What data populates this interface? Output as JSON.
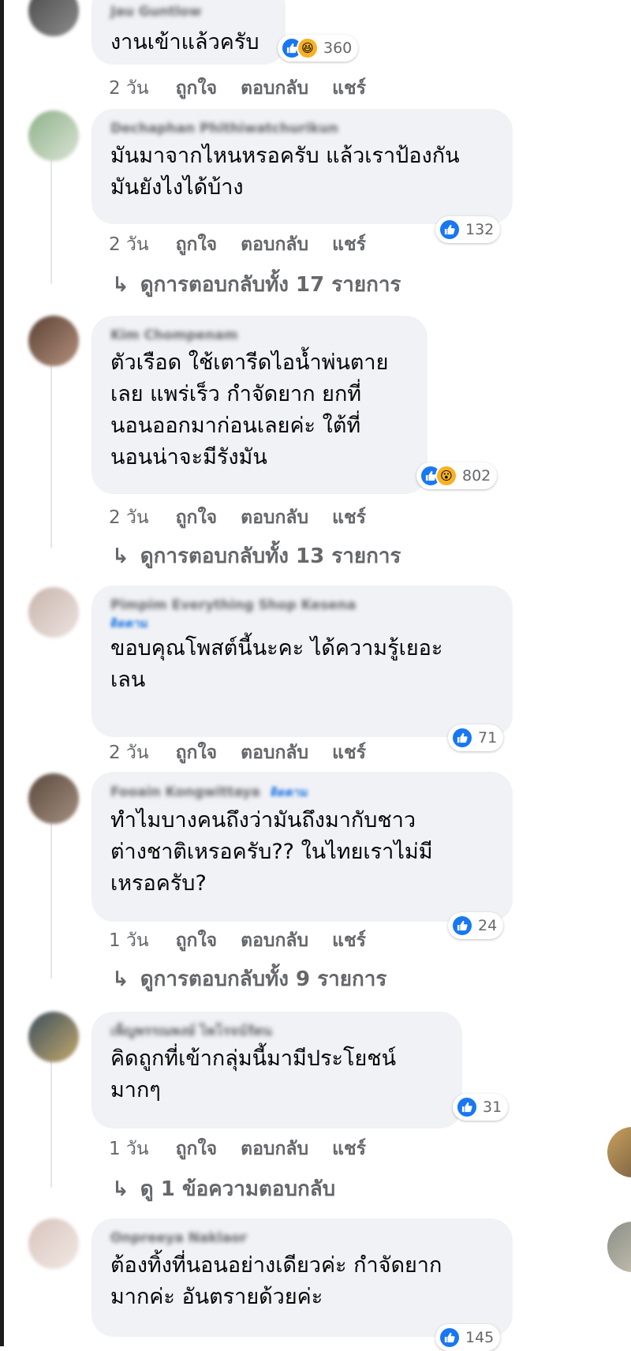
{
  "comments": [
    {
      "author": "Jau Guntlow",
      "badge": "",
      "text": "งานเข้าแล้วครับ",
      "reactions": [
        "like",
        "haha"
      ],
      "reaction_count": "360",
      "time": "2 วัน",
      "like": "ถูกใจ",
      "reply": "ตอบกลับ",
      "share": "แชร์",
      "view_replies": ""
    },
    {
      "author": "Dechaphan Phithiwatchurikun",
      "badge": "",
      "text": "มันมาจากไหนหรอครับ แล้วเราป้องกัน\nมันยังไงได้บ้าง",
      "reactions": [
        "like"
      ],
      "reaction_count": "132",
      "time": "2 วัน",
      "like": "ถูกใจ",
      "reply": "ตอบกลับ",
      "share": "แชร์",
      "view_replies": "ดูการตอบกลับทั้ง 17 รายการ"
    },
    {
      "author": "Kim Chompenam",
      "badge": "",
      "text": "ตัวเรือด ใช้เตารีดไอน้ำพ่นตาย\nเลย แพร่เร็ว กำจัดยาก ยกที่\nนอนออกมาก่อนเลยค่ะ ใต้ที่\nนอนน่าจะมีรังมัน",
      "reactions": [
        "like",
        "wow"
      ],
      "reaction_count": "802",
      "time": "2 วัน",
      "like": "ถูกใจ",
      "reply": "ตอบกลับ",
      "share": "แชร์",
      "view_replies": "ดูการตอบกลับทั้ง 13 รายการ"
    },
    {
      "author": "Pimpim Everything Shop Kesena",
      "badge": "ติดตาม",
      "text": "ขอบคุณโพสต์นี้นะคะ ได้ความรู้เยอะ\nเลน",
      "reactions": [
        "like"
      ],
      "reaction_count": "71",
      "time": "2 วัน",
      "like": "ถูกใจ",
      "reply": "ตอบกลับ",
      "share": "แชร์",
      "view_replies": ""
    },
    {
      "author": "Fooain Kongwittaya",
      "badge": "ติดตาม",
      "text": "ทำไมบางคนถึงว่ามันถึงมากับชาว\nต่างชาติเหรอครับ?? ในไทยเราไม่มี\nเหรอครับ?",
      "reactions": [
        "like"
      ],
      "reaction_count": "24",
      "time": "1 วัน",
      "like": "ถูกใจ",
      "reply": "ตอบกลับ",
      "share": "แชร์",
      "view_replies": "ดูการตอบกลับทั้ง 9 รายการ"
    },
    {
      "author": "เพ็ญพรรณพงษ์ ไพโรจน์รัตน",
      "badge": "",
      "text": "คิดถูกที่เข้ากลุ่มนี้มามีประโยชน์\nมากๆ",
      "reactions": [
        "like"
      ],
      "reaction_count": "31",
      "time": "1 วัน",
      "like": "ถูกใจ",
      "reply": "ตอบกลับ",
      "share": "แชร์",
      "view_replies": "ดู 1 ข้อความตอบกลับ"
    },
    {
      "author": "Onpreeya Naklaor",
      "badge": "",
      "text": "ต้องทิ้งที่นอนอย่างเดียวค่ะ กำจัดยาก\nมากค่ะ อันตรายด้วยค่ะ",
      "reactions": [
        "like"
      ],
      "reaction_count": "145",
      "time": "",
      "like": "",
      "reply": "",
      "share": "",
      "view_replies": ""
    }
  ],
  "colors": {
    "bubble": "#f0f2f5",
    "secondary_text": "#65676b",
    "like_blue": "#1877f2",
    "follow_blue": "#1b74e4",
    "haha_yellow": "#f7b125"
  }
}
